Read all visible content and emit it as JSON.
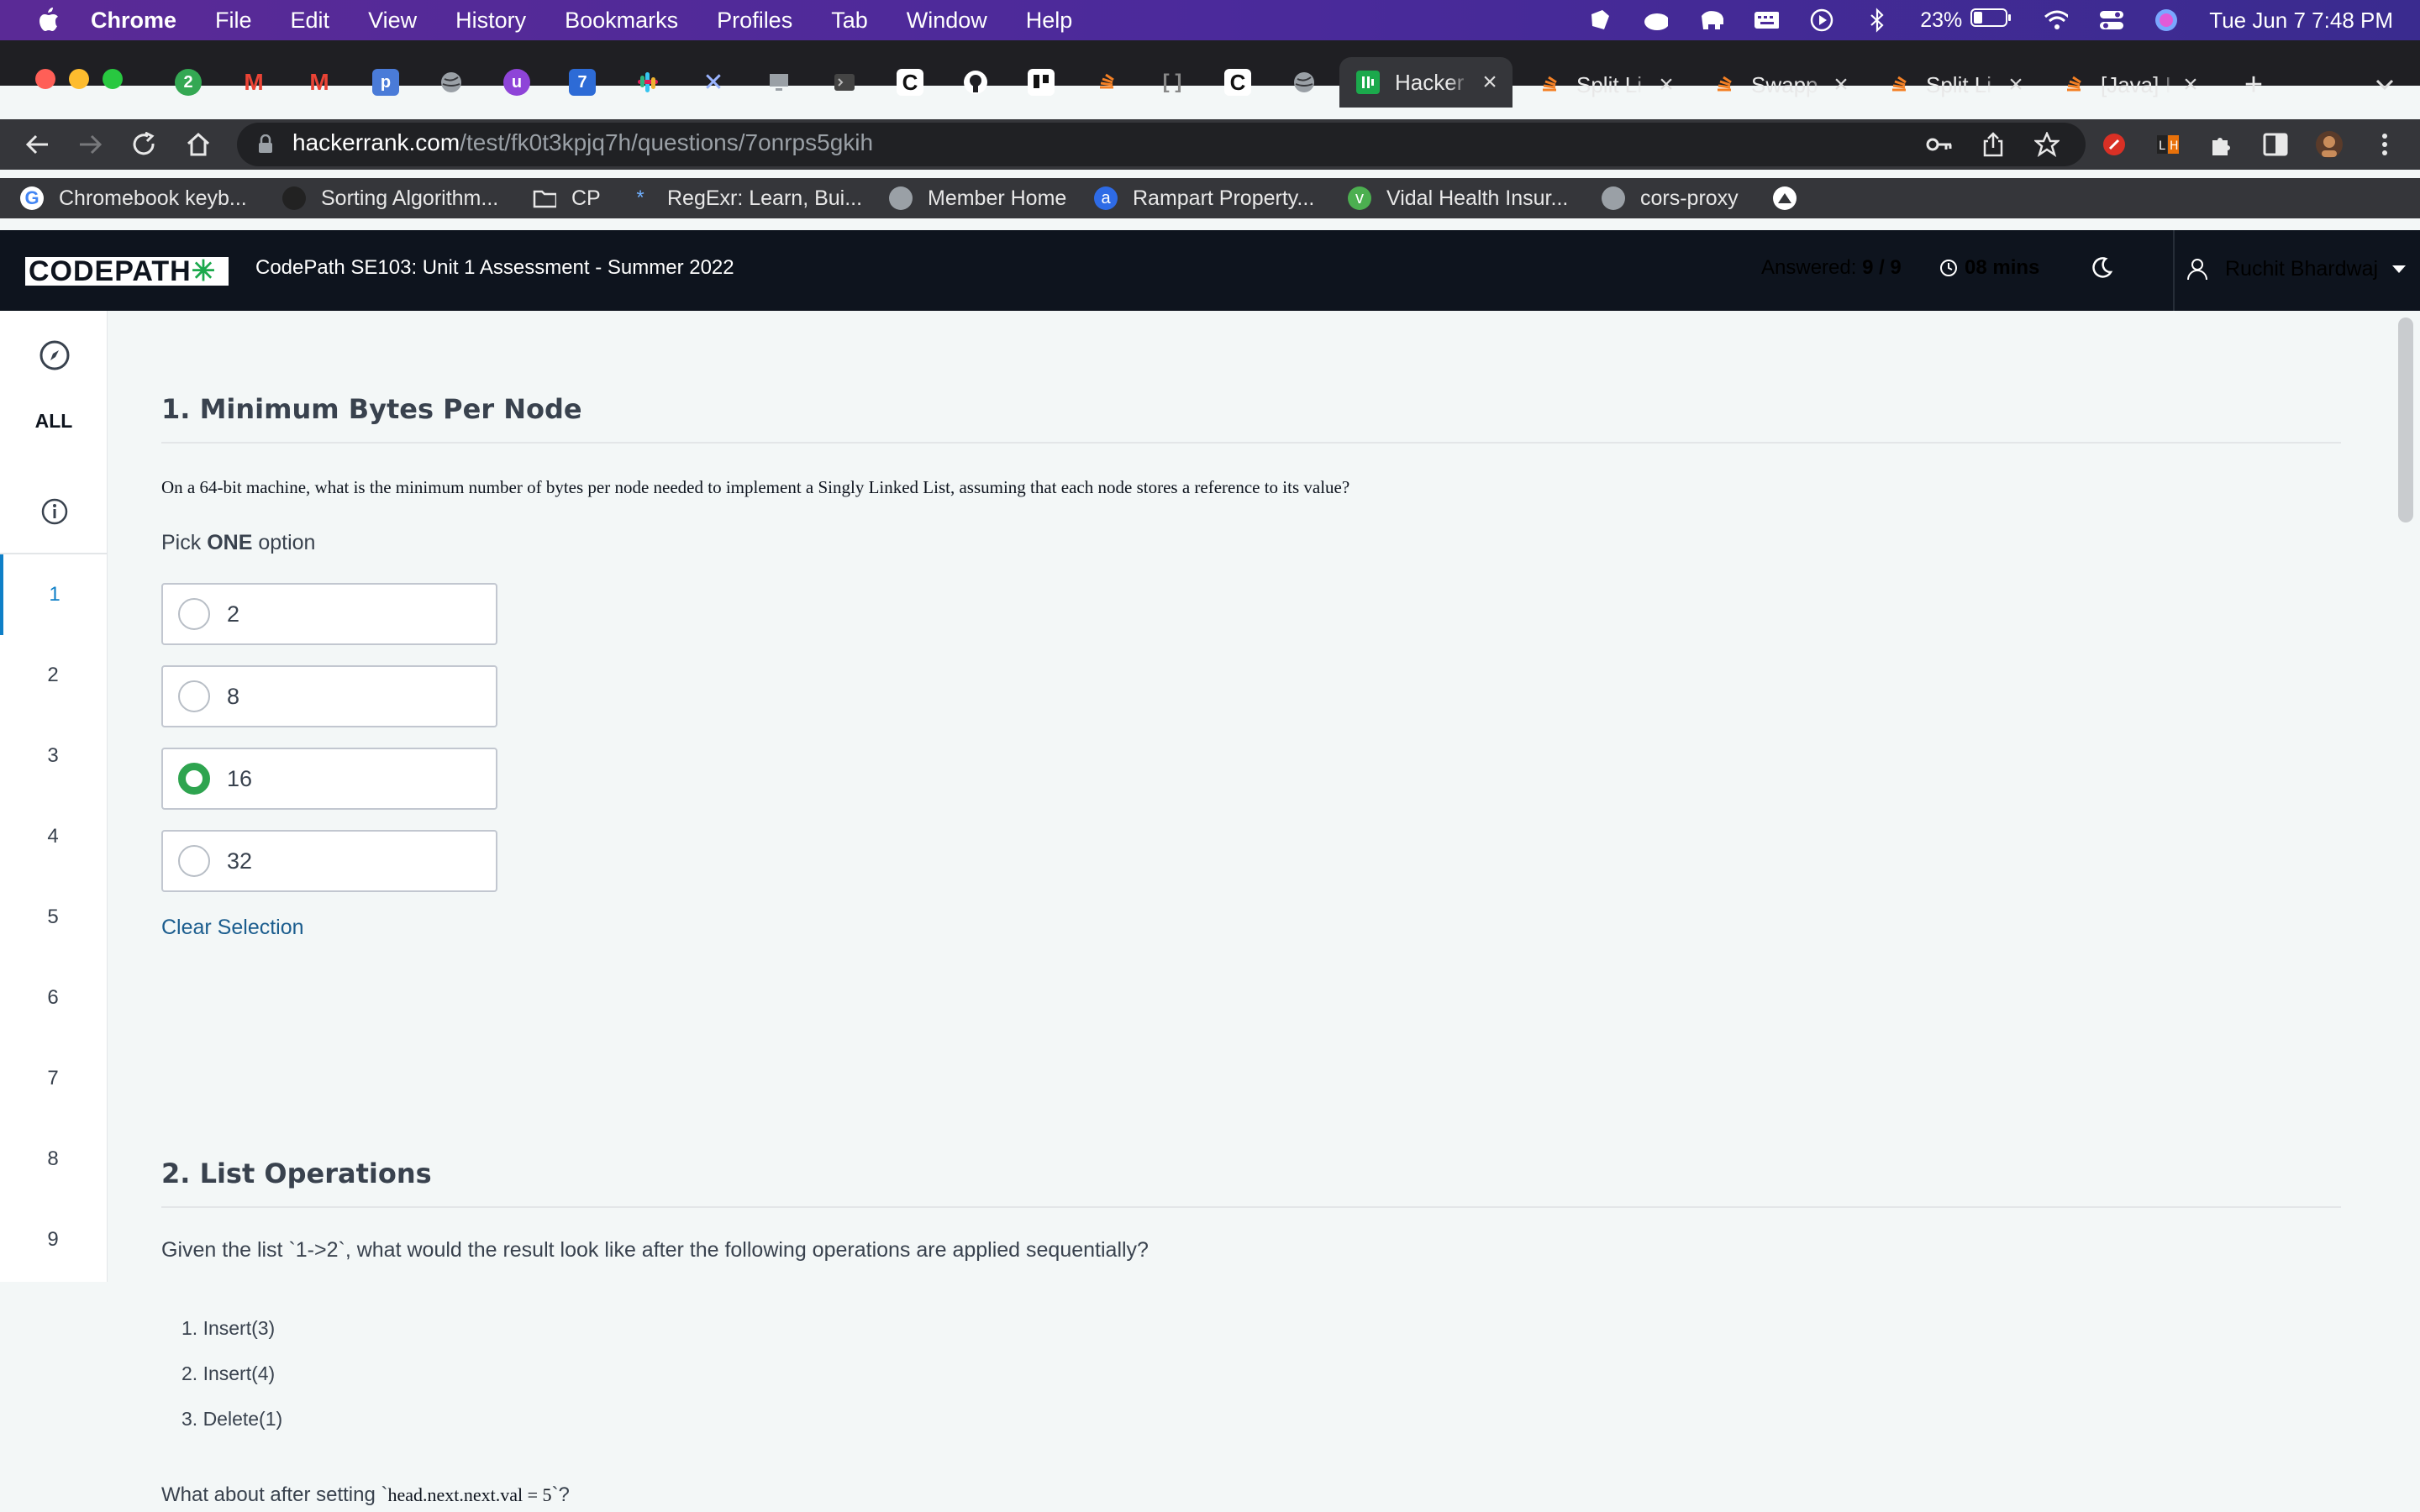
{
  "menubar": {
    "app_name": "Chrome",
    "menus": [
      "File",
      "Edit",
      "View",
      "History",
      "Bookmarks",
      "Profiles",
      "Tab",
      "Window",
      "Help"
    ],
    "battery": "23%",
    "datetime": "Tue Jun 7  7:48 PM"
  },
  "tabs": {
    "pinned_badge": "2",
    "active_title": "Hacker",
    "others": [
      "Split Li",
      "Swapp",
      "Split Li",
      "[Java] I"
    ]
  },
  "toolbar": {
    "url_host": "hackerrank.com",
    "url_path": "/test/fk0t3kpjq7h/questions/7onrps5gkih"
  },
  "bookmarks": [
    "Chromebook keyb...",
    "Sorting Algorithm...",
    "CP",
    "RegExr: Learn, Bui...",
    "Member Home",
    "Rampart Property...",
    "Vidal Health Insur...",
    "cors-proxy"
  ],
  "header": {
    "logo": "CODEPATH",
    "test_title": "CodePath SE103: Unit 1 Assessment - Summer 2022",
    "answered_label": "Answered:",
    "answered_value": "9 / 9",
    "timer": "08 mins",
    "user_name": "Ruchit Bhardwaj"
  },
  "leftnav": {
    "all_label": "ALL",
    "questions": [
      "1",
      "2",
      "3",
      "4",
      "5",
      "6",
      "7",
      "8",
      "9"
    ]
  },
  "q1": {
    "title": "1. Minimum Bytes Per Node",
    "body": "On a 64-bit machine, what is the minimum number of bytes per node needed to implement a Singly Linked List, assuming that each node stores a reference to its value?",
    "pick_prefix": "Pick",
    "pick_bold": "ONE",
    "pick_suffix": "option",
    "options": [
      "2",
      "8",
      "16",
      "32"
    ],
    "selected": "16",
    "clear_label": "Clear Selection"
  },
  "q2": {
    "title": "2. List Operations",
    "body": "Given the list `1->2`, what would the result look like after the following operations are applied sequentially?",
    "steps": [
      "1.  Insert(3)",
      "2.  Insert(4)",
      "3.  Delete(1)"
    ],
    "followup_prefix": "What about after setting `",
    "followup_code": "head.next.next.val = 5",
    "followup_suffix": "`?"
  }
}
